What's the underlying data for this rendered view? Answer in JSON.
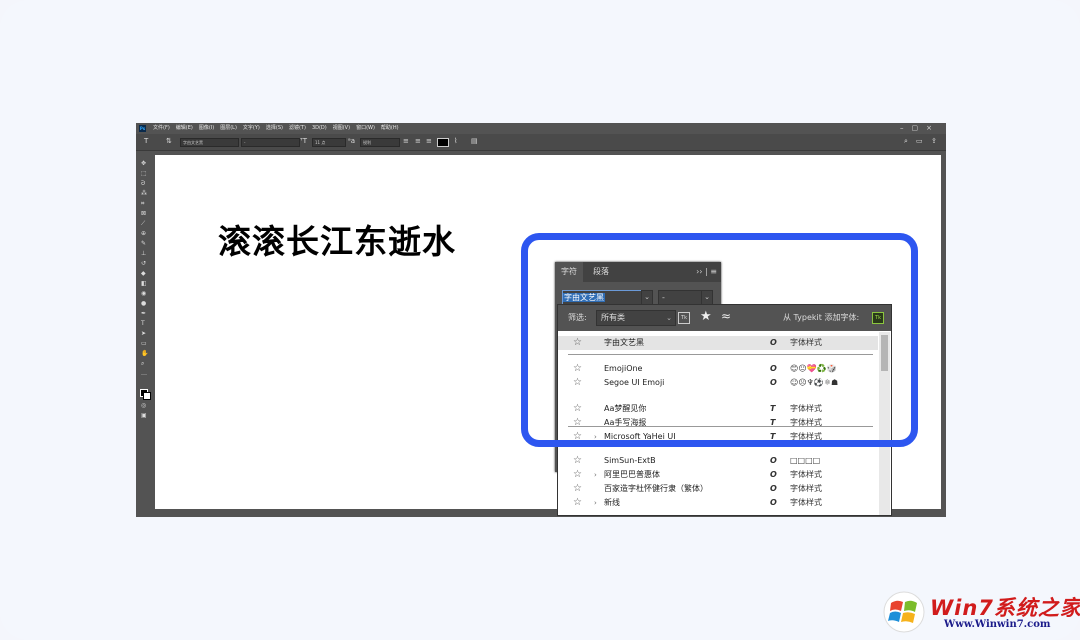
{
  "menu": {
    "items": [
      "文件(F)",
      "编辑(E)",
      "图像(I)",
      "图层(L)",
      "文字(Y)",
      "选择(S)",
      "滤镜(T)",
      "3D(D)",
      "视图(V)",
      "窗口(W)",
      "帮助(H)"
    ],
    "app_badge": "Ps"
  },
  "options_bar": {
    "font_family": "字由文艺黑",
    "font_style": "-",
    "font_size": "11 点",
    "antialias": "锐利"
  },
  "canvas": {
    "headline": "滚滚长江东逝水"
  },
  "character_panel": {
    "tabs": [
      "字符",
      "段落"
    ],
    "font_family": "字由文艺黑",
    "font_style": "-"
  },
  "font_list": {
    "filter_label": "筛选:",
    "filter_value": "所有类",
    "tk_label": "Tk",
    "typekit_text": "从 Typekit 添加字体:",
    "rows": [
      {
        "name": "字由文艺黑",
        "type": "O",
        "sample": "字体样式",
        "highlighted": true
      },
      {
        "name": "EmojiOne",
        "type": "O",
        "sample": "😊😐💝♻️🎲"
      },
      {
        "name": "Segoe UI Emoji",
        "type": "O",
        "sample": "☺☹♆⚽⚛☗"
      },
      {
        "name": "Aa梦醒见你",
        "type": "T",
        "sample": "字体样式"
      },
      {
        "name": "Aa手写海报",
        "type": "T",
        "sample": "字体样式"
      },
      {
        "name": "Microsoft YaHei UI",
        "type": "T",
        "sample": "字体样式",
        "expandable": true
      },
      {
        "name": "SimSun-ExtB",
        "type": "O",
        "sample": "□□□□"
      },
      {
        "name": "阿里巴巴普惠体",
        "type": "O",
        "sample": "字体样式",
        "expandable": true
      },
      {
        "name": "百家造字杜怀健行隶（繁体）",
        "type": "O",
        "sample": "字体样式"
      },
      {
        "name": "新线",
        "type": "O",
        "sample": "字体样式",
        "expandable": true
      }
    ]
  },
  "watermark": {
    "title": "Win7系统之家",
    "url": "Www.Winwin7.com"
  },
  "colors": {
    "highlight": "#2d56f0",
    "ps_dark": "#535353"
  }
}
